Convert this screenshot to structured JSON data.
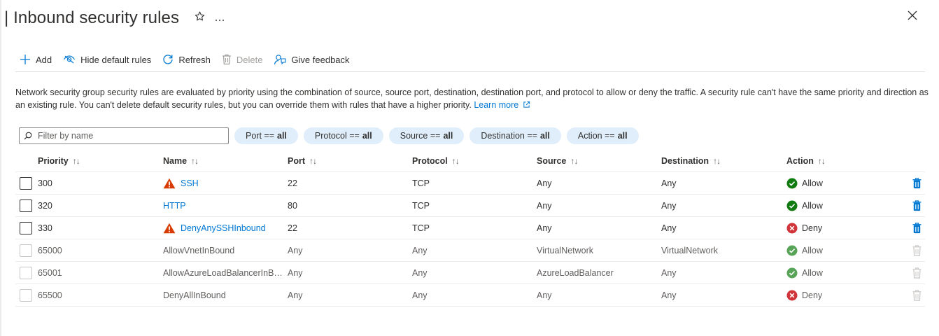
{
  "page": {
    "title": "| Inbound security rules",
    "star_icon": "star-icon",
    "more_icon": "ellipsis-icon",
    "close_icon": "close-icon"
  },
  "toolbar": {
    "add": "Add",
    "hide_default": "Hide default rules",
    "refresh": "Refresh",
    "delete": "Delete",
    "feedback": "Give feedback"
  },
  "description": {
    "text": "Network security group security rules are evaluated by priority using the combination of source, source port, destination, destination port, and protocol to allow or deny the traffic. A security rule can't have the same priority and direction as an existing rule. You can't delete default security rules, but you can override them with rules that have a higher priority.",
    "learn_more": "Learn more"
  },
  "filters": {
    "search_placeholder": "Filter by name",
    "pills": [
      {
        "label": "Port ==",
        "value": "all"
      },
      {
        "label": "Protocol ==",
        "value": "all"
      },
      {
        "label": "Source ==",
        "value": "all"
      },
      {
        "label": "Destination ==",
        "value": "all"
      },
      {
        "label": "Action ==",
        "value": "all"
      }
    ]
  },
  "table": {
    "columns": [
      "Priority",
      "Name",
      "Port",
      "Protocol",
      "Source",
      "Destination",
      "Action"
    ],
    "sort_glyph": "↑↓",
    "rows": [
      {
        "priority": "300",
        "name": "SSH",
        "port": "22",
        "protocol": "TCP",
        "source": "Any",
        "destination": "Any",
        "action": "Allow"
      },
      {
        "priority": "320",
        "name": "HTTP",
        "port": "80",
        "protocol": "TCP",
        "source": "Any",
        "destination": "Any",
        "action": "Allow"
      },
      {
        "priority": "330",
        "name": "DenyAnySSHInbound",
        "port": "22",
        "protocol": "TCP",
        "source": "Any",
        "destination": "Any",
        "action": "Deny"
      },
      {
        "priority": "65000",
        "name": "AllowVnetInBound",
        "port": "Any",
        "protocol": "Any",
        "source": "VirtualNetwork",
        "destination": "VirtualNetwork",
        "action": "Allow"
      },
      {
        "priority": "65001",
        "name": "AllowAzureLoadBalancerInB…",
        "port": "Any",
        "protocol": "Any",
        "source": "AzureLoadBalancer",
        "destination": "Any",
        "action": "Allow"
      },
      {
        "priority": "65500",
        "name": "DenyAllInBound",
        "port": "Any",
        "protocol": "Any",
        "source": "Any",
        "destination": "Any",
        "action": "Deny"
      }
    ]
  },
  "colors": {
    "accent": "#0078d4",
    "allow": "#107c10",
    "deny": "#d13438",
    "warning": "#d83b01",
    "pill_bg": "#dfeefa"
  }
}
